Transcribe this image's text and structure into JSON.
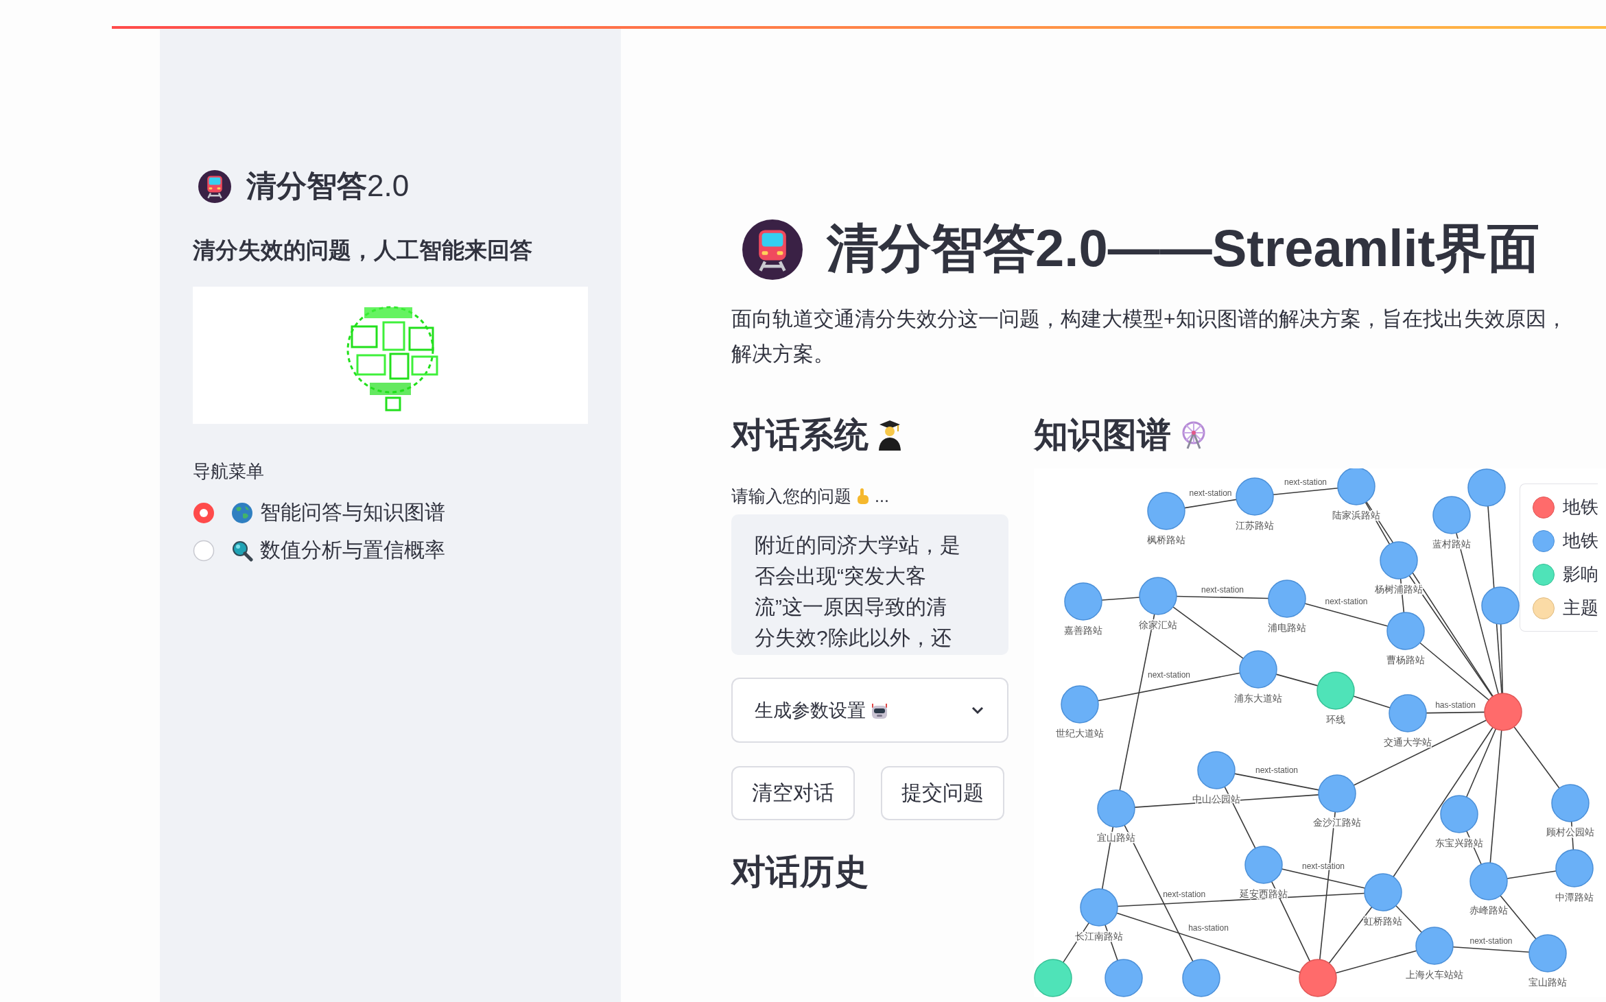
{
  "sidebar": {
    "title": "**清分智答**2.0",
    "subtitle": "清分失效的问题，人工智能来回答",
    "nav": {
      "label": "导航菜单",
      "options": [
        {
          "label": "智能问答与知识图谱",
          "selected": true
        },
        {
          "label": "数值分析与置信概率",
          "selected": false
        }
      ]
    }
  },
  "page": {
    "title": "清分智答2.0——Streamlit界面",
    "description": [
      "面向轨道交通清分失效分这一问题，构建大模型+知识图谱的解决方案，旨在找出失效原因，",
      "解决方案。"
    ]
  },
  "chat": {
    "heading": "对话系统",
    "input": {
      "label": "请输入您的问题",
      "suffix": "...",
      "lines": [
        "附近的同济大学站，是",
        "否会出现“突发大客",
        "流”这一原因导致的清",
        "分失效?除此以外，还"
      ]
    },
    "settings": {
      "label": "生成参数设置",
      "expanded": false
    },
    "buttons": [
      "清空对话",
      "提交问题"
    ],
    "history_heading": "对话历史"
  },
  "graph": {
    "heading": "知识图谱",
    "legend": [
      {
        "kind": "line",
        "label": "地铁",
        "color": "#ff6b6b"
      },
      {
        "kind": "station",
        "label": "地铁",
        "color": "#6ab0f7"
      },
      {
        "kind": "factor",
        "label": "影响",
        "color": "#4fe3b8"
      },
      {
        "kind": "topic",
        "label": "主题",
        "color": "#fbdba6"
      }
    ],
    "nodes": [
      {
        "kind": "station",
        "label": "枫桥路站"
      },
      {
        "kind": "station",
        "label": "江苏路站"
      },
      {
        "kind": "station",
        "label": "陆家浜路站"
      },
      {
        "kind": "station",
        "label": "蓝村路站"
      },
      {
        "kind": "station",
        "label": "杨树浦路站"
      },
      {
        "kind": "station",
        "label": "嘉善路站"
      },
      {
        "kind": "station",
        "label": "徐家汇站"
      },
      {
        "kind": "station",
        "label": "浦电路站"
      },
      {
        "kind": "station",
        "label": "曹杨路站"
      },
      {
        "kind": "station",
        "label": "浦东大道站"
      },
      {
        "kind": "factor",
        "label": "环线"
      },
      {
        "kind": "station",
        "label": "交通大学站"
      },
      {
        "kind": "line"
      },
      {
        "kind": "station"
      },
      {
        "kind": "station",
        "label": "世纪大道站"
      },
      {
        "kind": "station",
        "label": "中山公园站"
      },
      {
        "kind": "station",
        "label": "金沙江路站"
      },
      {
        "kind": "station",
        "label": "宜山路站"
      },
      {
        "kind": "station",
        "label": "东宝兴路站"
      },
      {
        "kind": "station",
        "label": "顾村公园站"
      },
      {
        "kind": "station",
        "label": "中潭路站"
      },
      {
        "kind": "station",
        "label": "延安西路站"
      },
      {
        "kind": "station",
        "label": "虹桥路站"
      },
      {
        "kind": "station",
        "label": "赤峰路站"
      },
      {
        "kind": "station",
        "label": "长江南路站"
      },
      {
        "kind": "station",
        "label": "上海火车站站"
      },
      {
        "kind": "station",
        "label": "宝山路站"
      },
      {
        "kind": "factor"
      },
      {
        "kind": "station"
      },
      {
        "kind": "station"
      },
      {
        "kind": "line"
      },
      {
        "kind": "station"
      }
    ],
    "edge_labels": [
      "next-station",
      "next-station",
      "next-station",
      "next-station",
      "next-station",
      "has-station",
      "next-station",
      "next-station",
      "next-station",
      "has-station",
      "next-station"
    ]
  }
}
